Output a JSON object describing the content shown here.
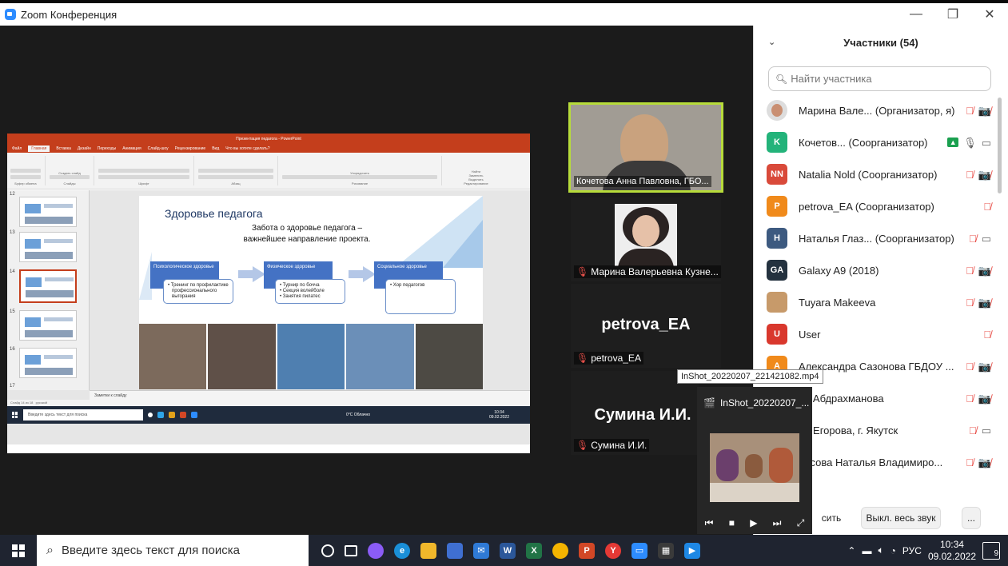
{
  "window": {
    "title": "Zoom Конференция"
  },
  "shared_screen": {
    "ppt_title": "Презентация педагога - PowerPoint",
    "tabs": [
      "Файл",
      "Главная",
      "Вставка",
      "Дизайн",
      "Переходы",
      "Анимация",
      "Слайд-шоу",
      "Рецензирование",
      "Вид",
      "Что вы хотите сделать?"
    ],
    "ribbon_groups": [
      "Буфер обмена",
      "Слайды",
      "Шрифт",
      "Абзац",
      "Рисование",
      "Редактирование"
    ],
    "ribbon_buttons": {
      "create_slide": "Создать слайд",
      "arrange": "Упорядочить",
      "find": "Найти",
      "replace": "Заменить",
      "select": "Выделить"
    },
    "thumb_numbers": [
      "12",
      "13",
      "14",
      "15",
      "16",
      "17"
    ],
    "slide": {
      "title": "Здоровье педагога",
      "subtitle_line1": "Забота о здоровье педагога –",
      "subtitle_line2": "важнейшее направление проекта.",
      "blocks": [
        {
          "label": "Психологическое здоровье",
          "items": [
            "Тренинг по профилактике профессионального выгорания"
          ]
        },
        {
          "label": "Физическое здоровье",
          "items": [
            "Турнир по бочча",
            "Секция волейболе",
            "Занятия пилатес"
          ]
        },
        {
          "label": "Социальное здоровье",
          "items": [
            "Хор педагогов"
          ]
        }
      ]
    },
    "notes_placeholder": "Заметки к слайду",
    "status": "Слайд 14 из 18",
    "status_lang": "русский",
    "mini_search": "Введите здесь текст для поиска",
    "mini_weather": "0°C Облачно",
    "mini_time": "10:34",
    "mini_date": "09.02.2022"
  },
  "video_tiles": [
    {
      "name": "Кочетова Анна Павловна, ГБО..."
    },
    {
      "name": "Марина Валерьевна Кузне..."
    },
    {
      "big": "petrova_EA",
      "name": "petrova_EA"
    },
    {
      "big": "Сумина И.И.",
      "name": "Сумина И.И."
    }
  ],
  "player": {
    "tooltip": "InShot_20220207_221421082.mp4",
    "title": "InShot_20220207_..."
  },
  "participants": {
    "header": "Участники (54)",
    "search_placeholder": "Найти участника",
    "list": [
      {
        "name": "Марина Вале... (Организатор, я)",
        "initials": "",
        "color": "#d9c3b0",
        "mic": "off",
        "cam": "off"
      },
      {
        "name": "Кочетов... (Соорганизатор)",
        "initials": "K",
        "color": "#23b37a",
        "mic": "on",
        "cam": "on",
        "share": true
      },
      {
        "name": "Natalia Nold (Соорганизатор)",
        "initials": "NN",
        "color": "#d94a3a",
        "mic": "off",
        "cam": "off"
      },
      {
        "name": "petrova_EA (Соорганизатор)",
        "initials": "P",
        "color": "#f08a1b",
        "mic": "off",
        "cam": "none"
      },
      {
        "name": "Наталья Глаз... (Соорганизатор)",
        "initials": "H",
        "color": "#3d5a80",
        "mic": "off",
        "cam": "on"
      },
      {
        "name": "Galaxy A9 (2018)",
        "initials": "GA",
        "color": "#24323f",
        "mic": "off",
        "cam": "off"
      },
      {
        "name": "Tuyara Makeeva",
        "initials": "",
        "color": "#c79a6a",
        "mic": "off",
        "cam": "off"
      },
      {
        "name": "User",
        "initials": "U",
        "color": "#d9382d",
        "mic": "off",
        "cam": "none"
      },
      {
        "name": "Александра Сазонова ГБДОУ ...",
        "initials": "A",
        "color": "#f08a1b",
        "mic": "off",
        "cam": "off"
      },
      {
        "name": "ия Абдрахманова",
        "initials": "",
        "color": "#9a5cc0",
        "mic": "off",
        "cam": "off"
      },
      {
        "name": "на Егорова, г. Якутск",
        "initials": "",
        "color": "#2d8cff",
        "mic": "off",
        "cam": "on"
      },
      {
        "name": "рисова Наталья Владимиро...",
        "initials": "",
        "color": "#23b37a",
        "mic": "off",
        "cam": "off"
      }
    ],
    "invite_label": "сить",
    "mute_all_label": "Выкл. весь звук",
    "more_label": "..."
  },
  "taskbar": {
    "search_placeholder": "Введите здесь текст для поиска",
    "lang": "РУС",
    "time": "10:34",
    "date": "09.02.2022",
    "notifications": "9"
  }
}
